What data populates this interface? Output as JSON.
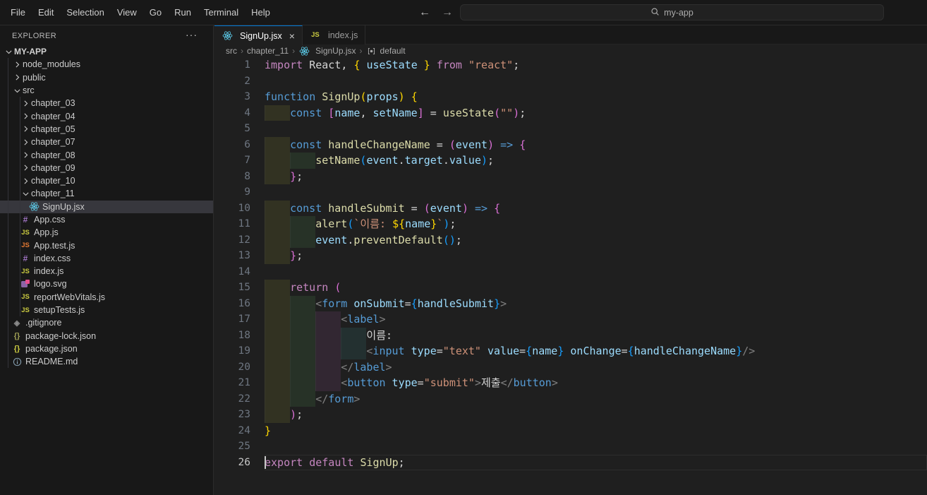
{
  "titlebar": {
    "menus": [
      "File",
      "Edit",
      "Selection",
      "View",
      "Go",
      "Run",
      "Terminal",
      "Help"
    ],
    "nav": {
      "back": "←",
      "forward": "→"
    },
    "search": {
      "value": "my-app"
    }
  },
  "sidebar": {
    "header": "EXPLORER",
    "more_label": "···",
    "tree": [
      {
        "label": "MY-APP",
        "level": 0,
        "type": "folder",
        "state": "expanded",
        "root": true
      },
      {
        "label": "node_modules",
        "level": 1,
        "type": "folder",
        "state": "collapsed"
      },
      {
        "label": "public",
        "level": 1,
        "type": "folder",
        "state": "collapsed"
      },
      {
        "label": "src",
        "level": 1,
        "type": "folder",
        "state": "expanded"
      },
      {
        "label": "chapter_03",
        "level": 2,
        "type": "folder",
        "state": "collapsed"
      },
      {
        "label": "chapter_04",
        "level": 2,
        "type": "folder",
        "state": "collapsed"
      },
      {
        "label": "chapter_05",
        "level": 2,
        "type": "folder",
        "state": "collapsed"
      },
      {
        "label": "chapter_07",
        "level": 2,
        "type": "folder",
        "state": "collapsed"
      },
      {
        "label": "chapter_08",
        "level": 2,
        "type": "folder",
        "state": "collapsed"
      },
      {
        "label": "chapter_09",
        "level": 2,
        "type": "folder",
        "state": "collapsed"
      },
      {
        "label": "chapter_10",
        "level": 2,
        "type": "folder",
        "state": "collapsed"
      },
      {
        "label": "chapter_11",
        "level": 2,
        "type": "folder",
        "state": "expanded"
      },
      {
        "label": "SignUp.jsx",
        "level": 3,
        "type": "react",
        "selected": true
      },
      {
        "label": "App.css",
        "level": 2,
        "type": "css"
      },
      {
        "label": "App.js",
        "level": 2,
        "type": "js"
      },
      {
        "label": "App.test.js",
        "level": 2,
        "type": "jstest"
      },
      {
        "label": "index.css",
        "level": 2,
        "type": "css"
      },
      {
        "label": "index.js",
        "level": 2,
        "type": "js"
      },
      {
        "label": "logo.svg",
        "level": 2,
        "type": "svg"
      },
      {
        "label": "reportWebVitals.js",
        "level": 2,
        "type": "js"
      },
      {
        "label": "setupTests.js",
        "level": 2,
        "type": "js"
      },
      {
        "label": ".gitignore",
        "level": 1,
        "type": "git"
      },
      {
        "label": "package-lock.json",
        "level": 1,
        "type": "jsonlock"
      },
      {
        "label": "package.json",
        "level": 1,
        "type": "json"
      },
      {
        "label": "README.md",
        "level": 1,
        "type": "info"
      }
    ]
  },
  "editor": {
    "tabs": [
      {
        "label": "SignUp.jsx",
        "icon": "react",
        "active": true,
        "close_label": "×"
      },
      {
        "label": "index.js",
        "icon": "js",
        "active": false
      }
    ],
    "breadcrumb": [
      {
        "label": "src"
      },
      {
        "label": "chapter_11"
      },
      {
        "label": "SignUp.jsx",
        "icon": "react"
      },
      {
        "label": "default",
        "icon": "symbol"
      }
    ],
    "code": {
      "cursor_line": 26,
      "lines": [
        {
          "n": 1,
          "indent": 0,
          "tokens": [
            [
              "ctrl",
              "import"
            ],
            [
              "txt",
              " React, "
            ],
            [
              "b1",
              "{"
            ],
            [
              "var",
              " useState "
            ],
            [
              "b1",
              "}"
            ],
            [
              "ctrl",
              " from "
            ],
            [
              "str",
              "\"react\""
            ],
            [
              "txt",
              ";"
            ]
          ]
        },
        {
          "n": 2,
          "indent": 0,
          "tokens": []
        },
        {
          "n": 3,
          "indent": 0,
          "tokens": [
            [
              "kw",
              "function "
            ],
            [
              "fn",
              "SignUp"
            ],
            [
              "b1",
              "("
            ],
            [
              "var",
              "props"
            ],
            [
              "b1",
              ")"
            ],
            [
              "txt",
              " "
            ],
            [
              "b1",
              "{"
            ]
          ]
        },
        {
          "n": 4,
          "indent": 1,
          "tokens": [
            [
              "kw",
              "const "
            ],
            [
              "b2",
              "["
            ],
            [
              "var",
              "name"
            ],
            [
              "txt",
              ", "
            ],
            [
              "var",
              "setName"
            ],
            [
              "b2",
              "]"
            ],
            [
              "txt",
              " = "
            ],
            [
              "fn",
              "useState"
            ],
            [
              "b2",
              "("
            ],
            [
              "str",
              "\"\""
            ],
            [
              "b2",
              ")"
            ],
            [
              "txt",
              ";"
            ]
          ]
        },
        {
          "n": 5,
          "indent": 0,
          "tokens": []
        },
        {
          "n": 6,
          "indent": 1,
          "tokens": [
            [
              "kw",
              "const "
            ],
            [
              "fn",
              "handleChangeName"
            ],
            [
              "txt",
              " = "
            ],
            [
              "b2",
              "("
            ],
            [
              "var",
              "event"
            ],
            [
              "b2",
              ")"
            ],
            [
              "kw",
              " => "
            ],
            [
              "b2",
              "{"
            ]
          ]
        },
        {
          "n": 7,
          "indent": 2,
          "tokens": [
            [
              "fn",
              "setName"
            ],
            [
              "b3",
              "("
            ],
            [
              "var",
              "event"
            ],
            [
              "txt",
              "."
            ],
            [
              "var",
              "target"
            ],
            [
              "txt",
              "."
            ],
            [
              "var",
              "value"
            ],
            [
              "b3",
              ")"
            ],
            [
              "txt",
              ";"
            ]
          ]
        },
        {
          "n": 8,
          "indent": 1,
          "tokens": [
            [
              "b2",
              "}"
            ],
            [
              "txt",
              ";"
            ]
          ]
        },
        {
          "n": 9,
          "indent": 0,
          "tokens": []
        },
        {
          "n": 10,
          "indent": 1,
          "tokens": [
            [
              "kw",
              "const "
            ],
            [
              "fn",
              "handleSubmit"
            ],
            [
              "txt",
              " = "
            ],
            [
              "b2",
              "("
            ],
            [
              "var",
              "event"
            ],
            [
              "b2",
              ")"
            ],
            [
              "kw",
              " => "
            ],
            [
              "b2",
              "{"
            ]
          ]
        },
        {
          "n": 11,
          "indent": 2,
          "tokens": [
            [
              "fn",
              "alert"
            ],
            [
              "b3",
              "("
            ],
            [
              "str",
              "`이름: "
            ],
            [
              "b1",
              "${"
            ],
            [
              "var",
              "name"
            ],
            [
              "b1",
              "}"
            ],
            [
              "str",
              "`"
            ],
            [
              "b3",
              ")"
            ],
            [
              "txt",
              ";"
            ]
          ]
        },
        {
          "n": 12,
          "indent": 2,
          "tokens": [
            [
              "var",
              "event"
            ],
            [
              "txt",
              "."
            ],
            [
              "fn",
              "preventDefault"
            ],
            [
              "b3",
              "()"
            ],
            [
              "txt",
              ";"
            ]
          ]
        },
        {
          "n": 13,
          "indent": 1,
          "tokens": [
            [
              "b2",
              "}"
            ],
            [
              "txt",
              ";"
            ]
          ]
        },
        {
          "n": 14,
          "indent": 0,
          "tokens": []
        },
        {
          "n": 15,
          "indent": 1,
          "tokens": [
            [
              "ctrl",
              "return "
            ],
            [
              "b2",
              "("
            ]
          ]
        },
        {
          "n": 16,
          "indent": 2,
          "tokens": [
            [
              "ang",
              "<"
            ],
            [
              "tag",
              "form"
            ],
            [
              "attr",
              " onSubmit"
            ],
            [
              "txt",
              "="
            ],
            [
              "b3",
              "{"
            ],
            [
              "var",
              "handleSubmit"
            ],
            [
              "b3",
              "}"
            ],
            [
              "ang",
              ">"
            ]
          ]
        },
        {
          "n": 17,
          "indent": 3,
          "tokens": [
            [
              "ang",
              "<"
            ],
            [
              "tag",
              "label"
            ],
            [
              "ang",
              ">"
            ]
          ]
        },
        {
          "n": 18,
          "indent": 4,
          "tokens": [
            [
              "txt",
              "이름:"
            ]
          ]
        },
        {
          "n": 19,
          "indent": 4,
          "tokens": [
            [
              "ang",
              "<"
            ],
            [
              "tag",
              "input"
            ],
            [
              "attr",
              " type"
            ],
            [
              "txt",
              "="
            ],
            [
              "str",
              "\"text\""
            ],
            [
              "attr",
              " value"
            ],
            [
              "txt",
              "="
            ],
            [
              "b3",
              "{"
            ],
            [
              "var",
              "name"
            ],
            [
              "b3",
              "}"
            ],
            [
              "attr",
              " onChange"
            ],
            [
              "txt",
              "="
            ],
            [
              "b3",
              "{"
            ],
            [
              "var",
              "handleChangeName"
            ],
            [
              "b3",
              "}"
            ],
            [
              "ang",
              "/>"
            ]
          ]
        },
        {
          "n": 20,
          "indent": 3,
          "tokens": [
            [
              "ang",
              "</"
            ],
            [
              "tag",
              "label"
            ],
            [
              "ang",
              ">"
            ]
          ]
        },
        {
          "n": 21,
          "indent": 3,
          "tokens": [
            [
              "ang",
              "<"
            ],
            [
              "tag",
              "button"
            ],
            [
              "attr",
              " type"
            ],
            [
              "txt",
              "="
            ],
            [
              "str",
              "\"submit\""
            ],
            [
              "ang",
              ">"
            ],
            [
              "txt",
              "제출"
            ],
            [
              "ang",
              "</"
            ],
            [
              "tag",
              "button"
            ],
            [
              "ang",
              ">"
            ]
          ]
        },
        {
          "n": 22,
          "indent": 2,
          "tokens": [
            [
              "ang",
              "</"
            ],
            [
              "tag",
              "form"
            ],
            [
              "ang",
              ">"
            ]
          ]
        },
        {
          "n": 23,
          "indent": 1,
          "tokens": [
            [
              "b2",
              ")"
            ],
            [
              "txt",
              ";"
            ]
          ]
        },
        {
          "n": 24,
          "indent": 0,
          "tokens": [
            [
              "b1",
              "}"
            ]
          ]
        },
        {
          "n": 25,
          "indent": 0,
          "tokens": []
        },
        {
          "n": 26,
          "indent": 0,
          "tokens": [
            [
              "ctrl",
              "export default "
            ],
            [
              "fn",
              "SignUp"
            ],
            [
              "txt",
              ";"
            ]
          ]
        }
      ]
    }
  },
  "colors": {
    "titlebar_bg": "#181818",
    "sidebar_bg": "#181818",
    "editor_bg": "#1f1f1f",
    "border": "#2b2b2b",
    "tab_accent": "#0078d4",
    "selection_row": "#37373d",
    "react_icon": "#61dafb",
    "js_icon": "#cbcb41",
    "js_test_icon": "#e37933",
    "css_icon": "#a074c4",
    "keyword": "#569cd6",
    "control": "#c586c0",
    "function": "#dcdcaa",
    "variable": "#9cdcfe",
    "string": "#ce9178",
    "plain_text": "#d4d4d4",
    "jsx_tag": "#569cd6",
    "jsx_attribute": "#9cdcfe",
    "jsx_angle": "#808080",
    "bracket_level1": "#ffd700",
    "bracket_level2": "#da70d6",
    "bracket_level3": "#179fff",
    "line_number": "#6e7681",
    "line_number_active": "#c6c6c6",
    "indent_rainbow": [
      "rgba(255,255,64,0.085)",
      "rgba(127,255,127,0.085)",
      "rgba(255,127,255,0.085)",
      "rgba(79,236,236,0.085)"
    ]
  }
}
